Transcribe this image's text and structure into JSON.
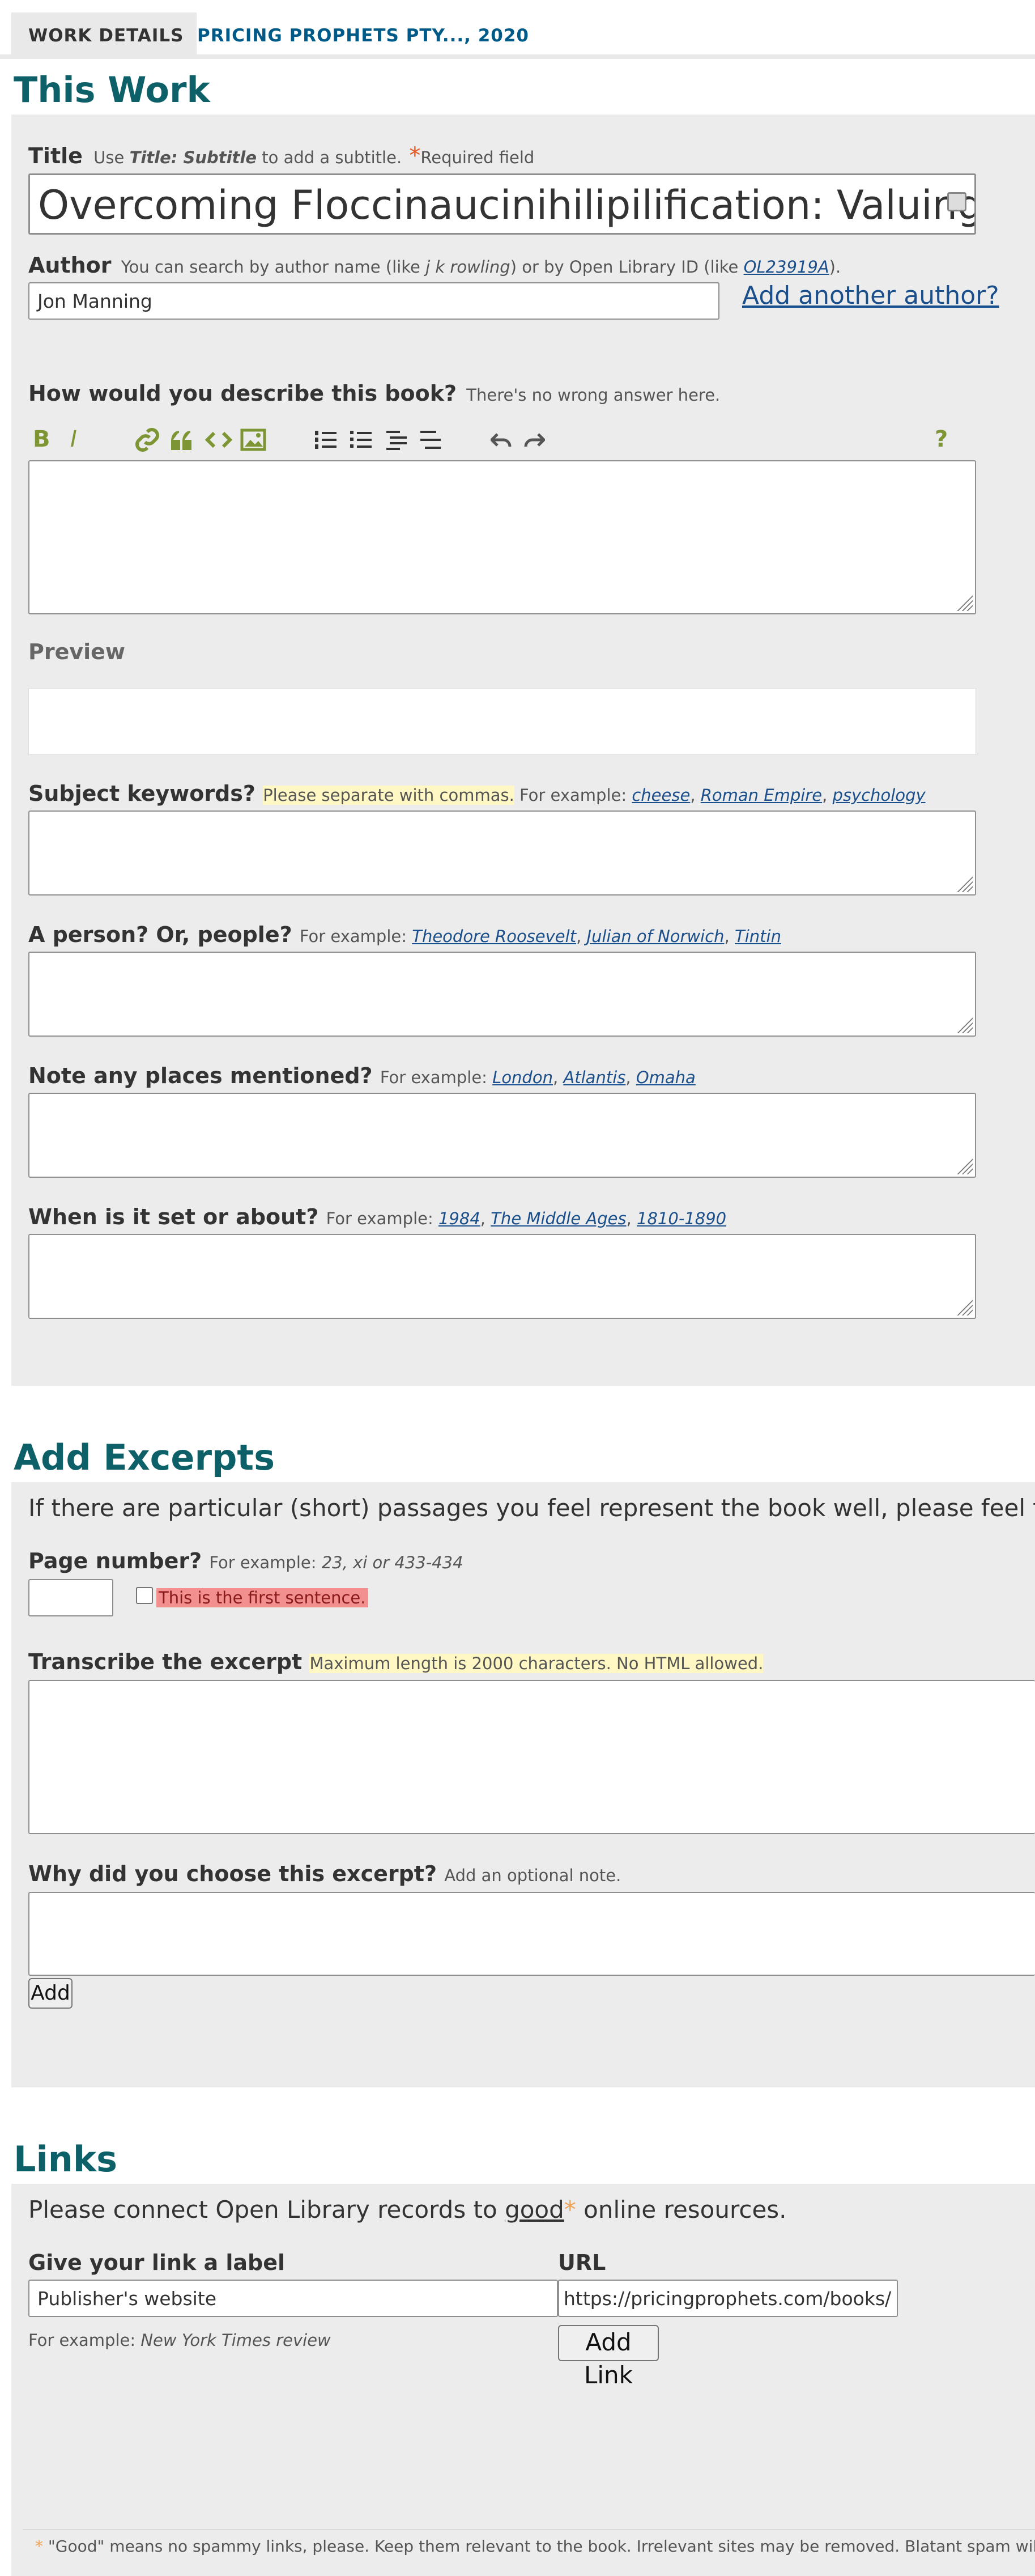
{
  "tabs": [
    {
      "label": "WORK DETAILS"
    },
    {
      "label": "PRICING PROPHETS PTY..., 2020"
    }
  ],
  "this_work": {
    "heading": "This Work",
    "title": {
      "label": "Title",
      "hint_pre": "Use",
      "hint_example": "Title: Subtitle",
      "hint_post": "to add a subtitle.",
      "required_star": "*",
      "required_text": "Required field",
      "value": "Overcoming Floccinaucinihilipilification: Valuing a"
    },
    "author": {
      "label": "Author",
      "hint_pre": "You can search by author name (like",
      "hint_example": "j k rowling",
      "hint_mid": ") or by Open Library ID (like",
      "hint_id": "OL23919A",
      "hint_post": ").",
      "value": "Jon Manning",
      "add_another": "Add another author?"
    },
    "description": {
      "label": "How would you describe this book?",
      "hint": "There's no wrong answer here.",
      "toolbar": {
        "bold": "B",
        "italic": "I",
        "help": "?"
      },
      "value": ""
    },
    "preview": {
      "label": "Preview"
    },
    "subjects": {
      "label": "Subject keywords?",
      "hint_highlight": "Please separate with commas.",
      "hint_pre": "For example:",
      "examples": [
        "cheese",
        "Roman Empire",
        "psychology"
      ]
    },
    "people": {
      "label": "A person? Or, people?",
      "hint_pre": "For example:",
      "examples": [
        "Theodore Roosevelt",
        "Julian of Norwich",
        "Tintin"
      ]
    },
    "places": {
      "label": "Note any places mentioned?",
      "hint_pre": "For example:",
      "examples": [
        "London",
        "Atlantis",
        "Omaha"
      ]
    },
    "times": {
      "label": "When is it set or about?",
      "hint_pre": "For example:",
      "examples": [
        "1984",
        "The Middle Ages",
        "1810-1890"
      ]
    }
  },
  "excerpts": {
    "heading": "Add Excerpts",
    "intro": "If there are particular (short) passages you feel represent the book well, please feel free",
    "page": {
      "label": "Page number?",
      "hint_pre": "For example:",
      "hint_example": "23, xi or 433-434",
      "first_sentence": "This is the first sentence."
    },
    "transcribe": {
      "label": "Transcribe the excerpt",
      "hint": "Maximum length is 2000 characters. No HTML allowed."
    },
    "why": {
      "label": "Why did you choose this excerpt?",
      "hint": "Add an optional note."
    },
    "add_button": "Add"
  },
  "links": {
    "heading": "Links",
    "intro_pre": "Please connect Open Library records to",
    "intro_good": "good",
    "intro_star": "*",
    "intro_post": "online resources.",
    "label_field": {
      "label": "Give your link a label",
      "value": "Publisher's website",
      "hint_pre": "For example:",
      "hint_example": "New York Times review"
    },
    "url_field": {
      "label": "URL",
      "value": "https://pricingprophets.com/books/"
    },
    "add_button": "Add Link",
    "footnote_star": "*",
    "footnote": "\"Good\" means no spammy links, please. Keep them relevant to the book. Irrelevant sites may be removed. Blatant spam will"
  },
  "colors": {
    "heading": "#0d5f68",
    "link": "#1a4f8b",
    "toolbar": "#7d9533",
    "required": "#e2541f",
    "highlight": "#fff7c4",
    "alert": "#f28f8f"
  }
}
